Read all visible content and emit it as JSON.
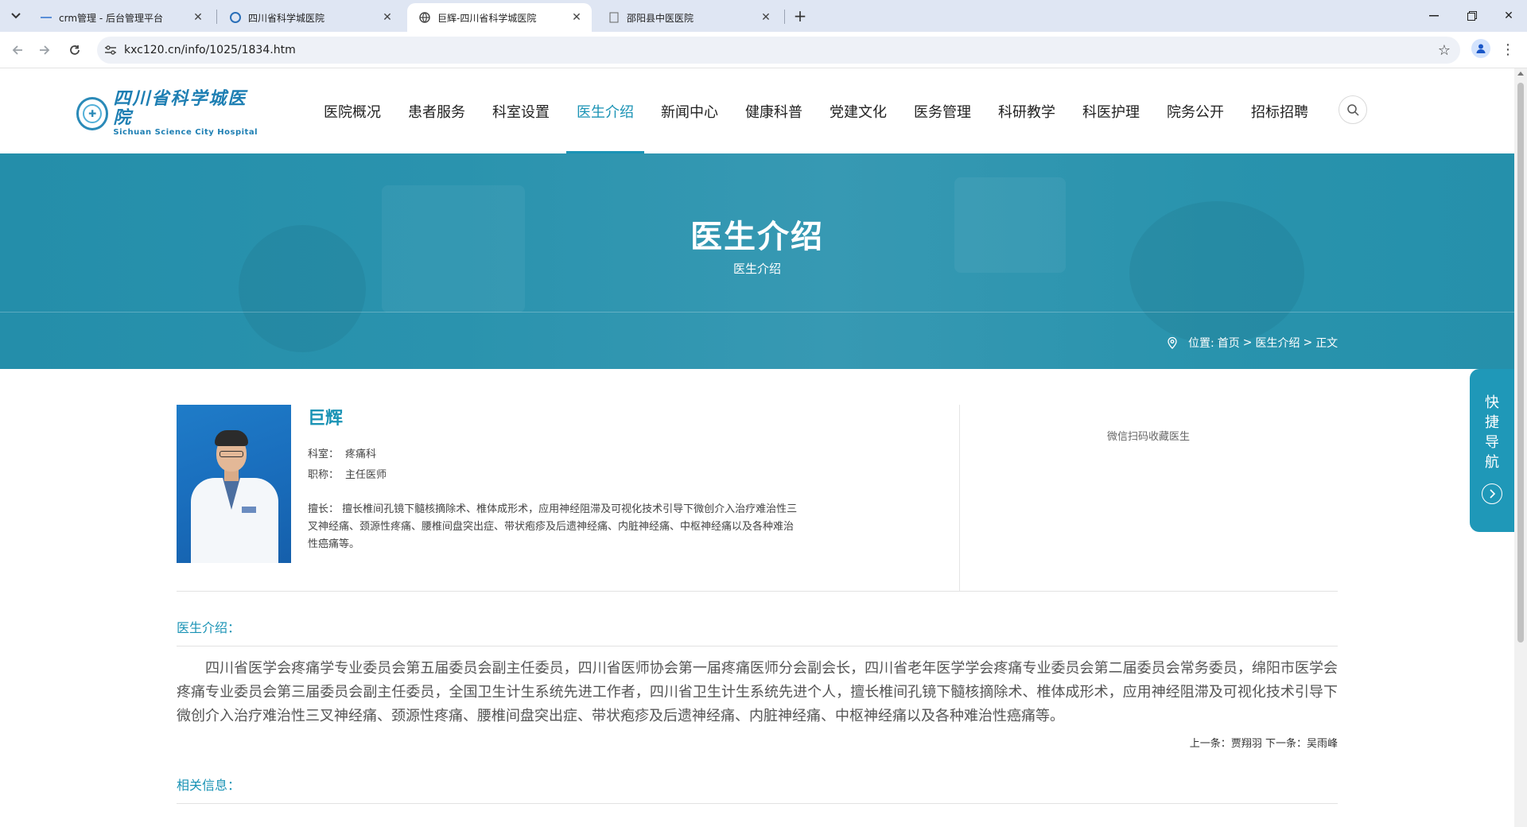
{
  "browser": {
    "tabs": [
      {
        "title": "crm管理 - 后台管理平台",
        "active": false
      },
      {
        "title": "四川省科学城医院",
        "active": false
      },
      {
        "title": "巨辉-四川省科学城医院",
        "active": true
      },
      {
        "title": "邵阳县中医医院",
        "active": false
      }
    ],
    "new_tab": "+",
    "url": "kxc120.cn/info/1025/1834.htm",
    "icons": {
      "tab_menu": "chevron-down-icon",
      "back": "arrow-left-icon",
      "forward": "arrow-right-icon",
      "reload": "reload-icon",
      "site_info": "tune-icon",
      "bookmark": "star-icon",
      "profile": "person-icon",
      "menu": "kebab-icon"
    }
  },
  "site": {
    "logo": {
      "cn": "四川省科学城医院",
      "en": "Sichuan Science City Hospital"
    },
    "nav": [
      "医院概况",
      "患者服务",
      "科室设置",
      "医生介绍",
      "新闻中心",
      "健康科普",
      "党建文化",
      "医务管理",
      "科研教学",
      "科医护理",
      "院务公开",
      "招标招聘"
    ],
    "nav_active": "医生介绍",
    "accent_color": "#1a93b5"
  },
  "banner": {
    "title": "医生介绍",
    "subtitle": "医生介绍",
    "breadcrumb": {
      "prefix": "位置:",
      "home": "首页",
      "sep1": ">",
      "section": "医生介绍",
      "sep2": ">",
      "current": "正文"
    }
  },
  "doctor": {
    "name": "巨辉",
    "department_label": "科室：",
    "department": "疼痛科",
    "title_label": "职称：",
    "title": "主任医师",
    "specialty_label": "擅长：",
    "specialty": "擅长椎间孔镜下髓核摘除术、椎体成形术，应用神经阻滞及可视化技术引导下微创介入治疗难治性三叉神经痛、颈源性疼痛、腰椎间盘突出症、带状疱疹及后遗神经痛、内脏神经痛、中枢神经痛以及各种难治性癌痛等。",
    "wechat_text": "微信扫码收藏医生"
  },
  "intro": {
    "heading": "医生介绍：",
    "body": "四川省医学会疼痛学专业委员会第五届委员会副主任委员，四川省医师协会第一届疼痛医师分会副会长，四川省老年医学学会疼痛专业委员会第二届委员会常务委员，绵阳市医学会疼痛专业委员会第三届委员会副主任委员，全国卫生计生系统先进工作者，四川省卫生计生系统先进个人，擅长椎间孔镜下髓核摘除术、椎体成形术，应用神经阻滞及可视化技术引导下微创介入治疗难治性三叉神经痛、颈源性疼痛、腰椎间盘突出症、带状疱疹及后遗神经痛、内脏神经痛、中枢神经痛以及各种难治性癌痛等。",
    "prev_label": "上一条：",
    "prev": "贾翔羽",
    "next_label": "下一条：",
    "next": "吴雨峰"
  },
  "related": {
    "heading": "相关信息："
  },
  "quicknav": {
    "chars": [
      "快",
      "捷",
      "导",
      "航"
    ]
  }
}
